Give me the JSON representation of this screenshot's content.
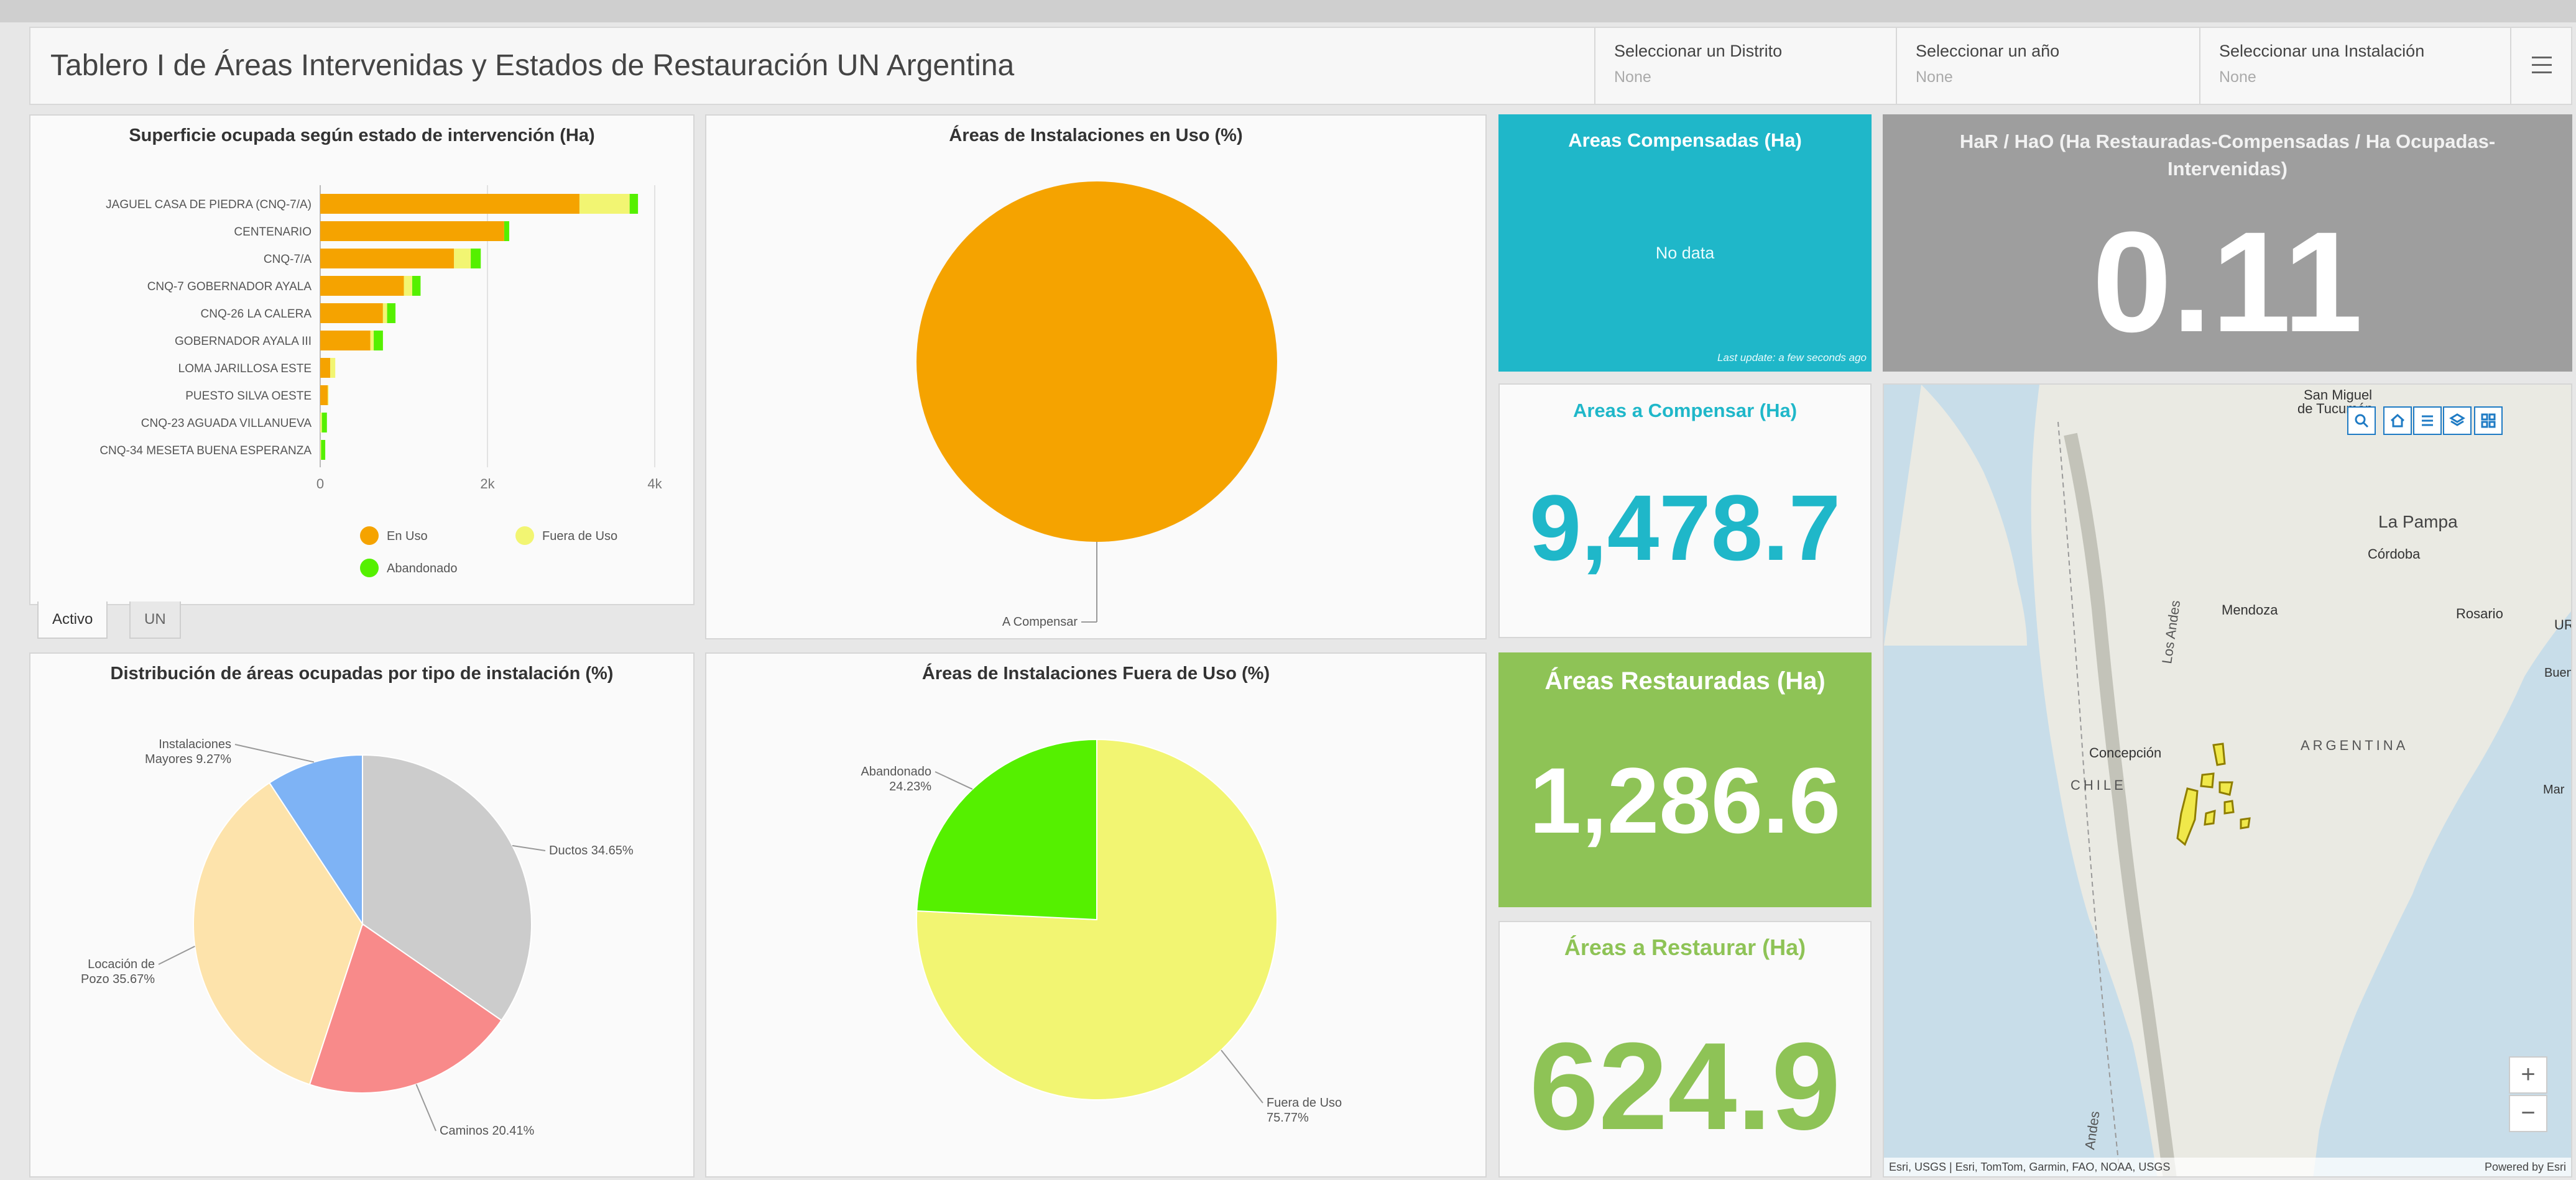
{
  "header": {
    "title": "Tablero I de Áreas Intervenidas y Estados de Restauración UN Argentina",
    "selectors": [
      {
        "label": "Seleccionar un Distrito",
        "value": "None"
      },
      {
        "label": "Seleccionar un año",
        "value": "None"
      },
      {
        "label": "Seleccionar una Instalación",
        "value": "None"
      }
    ],
    "menu_icon": "hamburger-menu-icon"
  },
  "bar_panel": {
    "title": "Superficie ocupada según estado de intervención (Ha)",
    "tabs": [
      "Activo",
      "UN"
    ],
    "active_tab": "Activo"
  },
  "pie_use_panel": {
    "title": "Áreas de Instalaciones en Uso (%)",
    "label": "A Compensar"
  },
  "pie_type_panel": {
    "title": "Distribución de áreas ocupadas por tipo de instalación (%)"
  },
  "pie_outuse_panel": {
    "title": "Áreas de Instalaciones Fuera de Uso (%)"
  },
  "kpi": {
    "compensadas": {
      "title": "Areas Compensadas (Ha)",
      "value": "No data",
      "note": "Last update: a few seconds ago",
      "color": "#1fb7c9"
    },
    "hr_ho": {
      "title": "HaR / HaO (Ha Restauradas-Compensadas / Ha Ocupadas-Intervenidas)",
      "value": "0.11",
      "color": "#9e9e9e"
    },
    "a_compensar": {
      "title": "Areas a Compensar (Ha)",
      "value": "9,478.7",
      "color": "#1fb7c9"
    },
    "restauradas": {
      "title": "Áreas Restauradas (Ha)",
      "value": "1,286.6",
      "color": "#8ec356"
    },
    "a_restaurar": {
      "title": "Áreas a Restaurar (Ha)",
      "value": "624.9",
      "color": "#8ec356"
    }
  },
  "map": {
    "labels": {
      "san_miguel": "San Miguel",
      "de_tucuman": "de Tucumán",
      "la_pampa": "La Pampa",
      "cordoba": "Córdoba",
      "mendoza": "Mendoza",
      "rosario": "Rosario",
      "ur": "UR",
      "buenos_aires": "Buenos A",
      "argentina": "ARGENTINA",
      "concepcion": "Concepción",
      "chile": "CHILE",
      "mar": "Mar",
      "los_andes": "Los Andes",
      "andes": "Andes"
    },
    "controls": [
      "search-icon",
      "home-icon",
      "legend-icon",
      "layers-icon",
      "basemap-icon"
    ],
    "zoom_in": "+",
    "zoom_out": "−",
    "attribution": "Esri, USGS | Esri, TomTom, Garmin, FAO, NOAA, USGS",
    "powered_by": "Powered by Esri"
  },
  "chart_data": [
    {
      "type": "bar",
      "orientation": "horizontal",
      "stacked": true,
      "title": "Superficie ocupada según estado de intervención (Ha)",
      "categories": [
        "JAGUEL CASA DE PIEDRA (CNQ-7/A)",
        "CENTENARIO",
        "CNQ-7/A",
        "CNQ-7 GOBERNADOR AYALA",
        "CNQ-26 LA CALERA",
        "GOBERNADOR AYALA III",
        "LOMA JARILLOSA ESTE",
        "PUESTO SILVA OESTE",
        "CNQ-23 AGUADA VILLANUEVA",
        "CNQ-34 MESETA BUENA ESPERANZA"
      ],
      "series": [
        {
          "name": "En Uso",
          "color": "#f5a300",
          "values": [
            3100,
            2200,
            1600,
            1000,
            750,
            600,
            120,
            90,
            0,
            0
          ]
        },
        {
          "name": "Fuera de Uso",
          "color": "#f2f572",
          "values": [
            600,
            0,
            200,
            100,
            50,
            40,
            60,
            10,
            20,
            10
          ]
        },
        {
          "name": "Abandonado",
          "color": "#55f000",
          "values": [
            100,
            60,
            120,
            100,
            100,
            110,
            0,
            0,
            60,
            50
          ]
        }
      ],
      "x_ticks": [
        "0",
        "2k",
        "4k"
      ],
      "xlim": [
        0,
        4000
      ],
      "legend_position": "bottom"
    },
    {
      "type": "pie",
      "title": "Áreas de Instalaciones en Uso (%)",
      "slices": [
        {
          "label": "A Compensar",
          "value": 100,
          "color": "#f5a300"
        }
      ]
    },
    {
      "type": "pie",
      "title": "Distribución de áreas ocupadas por tipo de instalación (%)",
      "slices": [
        {
          "label": "Ductos",
          "value": 34.65,
          "text": "Ductos 34.65%",
          "color": "#cccccc"
        },
        {
          "label": "Caminos",
          "value": 20.41,
          "text": "Caminos 20.41%",
          "color": "#f88a8a"
        },
        {
          "label": "Locación de Pozo",
          "value": 35.67,
          "text_lines": [
            "Locación de",
            "Pozo 35.67%"
          ],
          "color": "#fde3ab"
        },
        {
          "label": "Instalaciones Mayores",
          "value": 9.27,
          "text_lines": [
            "Instalaciones",
            "Mayores 9.27%"
          ],
          "color": "#7eb3f5"
        }
      ]
    },
    {
      "type": "pie",
      "title": "Áreas de Instalaciones Fuera de Uso (%)",
      "slices": [
        {
          "label": "Fuera de Uso",
          "value": 75.77,
          "text_lines": [
            "Fuera de Uso",
            "75.77%"
          ],
          "color": "#f2f572"
        },
        {
          "label": "Abandonado",
          "value": 24.23,
          "text_lines": [
            "Abandonado",
            "24.23%"
          ],
          "color": "#55f000"
        }
      ]
    }
  ]
}
